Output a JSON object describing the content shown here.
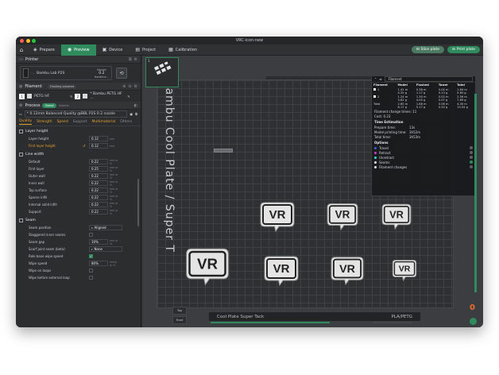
{
  "window": {
    "title": "VRC-icon-new",
    "traffic_colors": [
      "#ff5f57",
      "#febc2e",
      "#28c840"
    ]
  },
  "topbar": {
    "tabs": [
      {
        "label": "Prepare",
        "icon": "cube-icon"
      },
      {
        "label": "Preview",
        "icon": "eye-icon"
      },
      {
        "label": "Device",
        "icon": "device-icon"
      },
      {
        "label": "Project",
        "icon": "project-icon"
      },
      {
        "label": "Calibration",
        "icon": "calibration-icon"
      }
    ],
    "slice_label": "Slice plate",
    "print_label": "Print plate"
  },
  "printer": {
    "header": "Printer",
    "name": "Bambu Lab P2S",
    "nozzle_label": "Nozzle",
    "nozzle_value": "0.2",
    "nozzle_sub": "Hardene..."
  },
  "filament": {
    "header": "Filament",
    "flushing_label": "Flushing volumes",
    "items": [
      {
        "num": "1",
        "name": "PETG HF"
      },
      {
        "num": "2",
        "name": "* Bambu PETG HF ..."
      }
    ]
  },
  "process": {
    "header": "Process",
    "global": "Global",
    "objects": "Objects",
    "profile": "* 0.12mm Balanced Quality @BBL P2S 0.2 nozzle",
    "tabs": [
      "Quality",
      "Strength",
      "Speed",
      "Support",
      "Multimaterial",
      "Others"
    ],
    "groups": [
      {
        "title": "Layer height",
        "rows": [
          {
            "label": "Layer height",
            "value": "0.12",
            "unit": "mm",
            "modified": false
          },
          {
            "label": "First layer height",
            "value": "0.12",
            "unit": "mm",
            "modified": true
          }
        ]
      },
      {
        "title": "Line width",
        "rows": [
          {
            "label": "Default",
            "value": "0.22",
            "unit": "mm or %"
          },
          {
            "label": "First layer",
            "value": "0.25",
            "unit": "mm or %"
          },
          {
            "label": "Outer wall",
            "value": "0.22",
            "unit": "mm or %"
          },
          {
            "label": "Inner wall",
            "value": "0.22",
            "unit": "mm or %"
          },
          {
            "label": "Top surface",
            "value": "0.22",
            "unit": "mm or %"
          },
          {
            "label": "Sparse infill",
            "value": "0.22",
            "unit": "mm or %"
          },
          {
            "label": "Internal solid infill",
            "value": "0.22",
            "unit": "mm or %"
          },
          {
            "label": "Support",
            "value": "0.22",
            "unit": "mm or %"
          }
        ]
      },
      {
        "title": "Seam",
        "rows": [
          {
            "label": "Seam position",
            "value": "Aligned",
            "unit": ""
          },
          {
            "label": "Staggered inner seams",
            "value": "",
            "unit": ""
          },
          {
            "label": "Seam gap",
            "value": "10%",
            "unit": "mm or %"
          },
          {
            "label": "Scarf joint seam (beta)",
            "value": "None",
            "unit": ""
          },
          {
            "label": "Role base wipe speed",
            "value": "",
            "unit": ""
          },
          {
            "label": "Wipe speed",
            "value": "80%",
            "unit": "mm/s or %"
          },
          {
            "label": "Wipe on loops",
            "value": "",
            "unit": ""
          },
          {
            "label": "Wipe before external loop",
            "value": "",
            "unit": ""
          }
        ]
      }
    ]
  },
  "viewport": {
    "plate_vertical_text": "Bambu Cool Plate / Super T",
    "plate_bottom_text": "Cool Plate Super Tack",
    "plate_bottom_right": "PLA/PETG",
    "object_label": "VR",
    "thumb_num": "1",
    "layer_top": "0",
    "corner_btn1": "Top",
    "corner_btn2": "Front"
  },
  "summary": {
    "header": "Filament",
    "columns": [
      "Filament",
      "Model",
      "Flushed",
      "Tower",
      "Total"
    ],
    "rows": [
      {
        "id": "1",
        "model": [
          "1.41 m",
          "4.35 g"
        ],
        "flushed": [
          "0.38 m",
          "1.17 g"
        ],
        "tower": [
          "0.04 m",
          "0.13 g"
        ],
        "total": [
          "1.84 m",
          "5.65 g"
        ]
      },
      {
        "id": "2",
        "model": [
          "1.24 m",
          "3.82 g"
        ],
        "flushed": [
          "1.30 m",
          "4.00 g"
        ],
        "tower": [
          "0.02 m",
          "0.07 g"
        ],
        "total": [
          "2.56 m",
          "7.89 g"
        ]
      }
    ],
    "total_row": {
      "label": "Total",
      "model": [
        "2.65 m",
        "8.17 g"
      ],
      "flushed": [
        "1.68 m",
        "5.17 g"
      ],
      "tower": [
        "0.06 m",
        "0.20 g"
      ],
      "total": [
        "4.40 m",
        "13.54 g"
      ]
    },
    "change_times_label": "Filament change times:",
    "change_times": "11",
    "cost_label": "Cost:",
    "cost": "0.23",
    "time_header": "Time Estimation",
    "times": [
      {
        "label": "Prepare time:",
        "value": "13s"
      },
      {
        "label": "Model printing time:",
        "value": "3h52m"
      },
      {
        "label": "Total time:",
        "value": "3h53m"
      }
    ],
    "options_header": "Options",
    "options": [
      {
        "label": "Travel",
        "color": "#3a5fd9",
        "on": false
      },
      {
        "label": "Retract",
        "color": "#d63ad6",
        "on": false
      },
      {
        "label": "Unretract",
        "color": "#3ad6d6",
        "on": false
      },
      {
        "label": "Seams",
        "color": "#e6e6e6",
        "on": true
      },
      {
        "label": "Filament changes",
        "color": "#e6e6e6",
        "on": false
      }
    ]
  }
}
